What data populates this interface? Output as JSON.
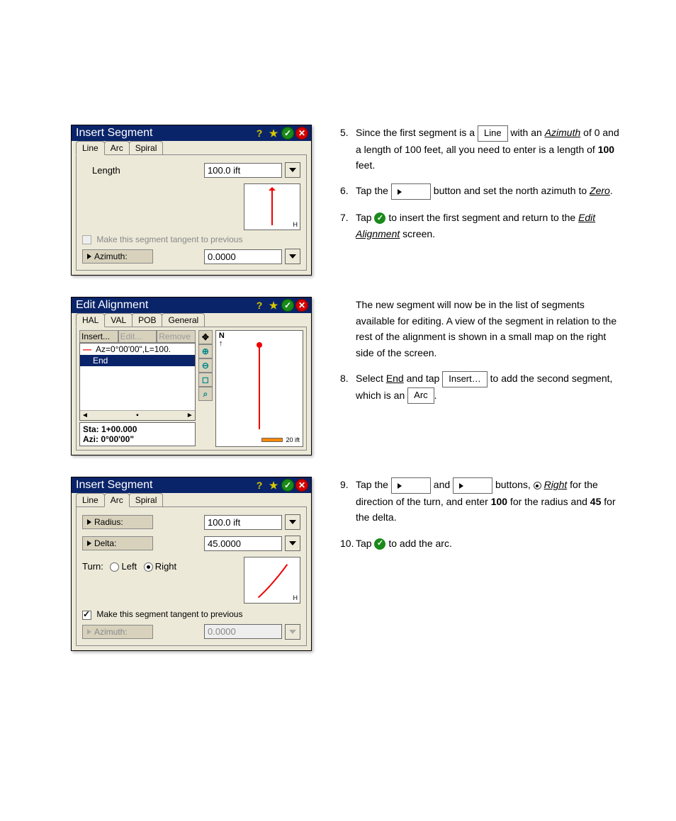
{
  "step_offset": 5,
  "dlg1": {
    "title": "Insert Segment",
    "tabs": [
      "Line",
      "Arc",
      "Spiral"
    ],
    "active_tab": 0,
    "length_label": "Length",
    "length_value": "100.0 ift",
    "tangent_label": "Make this segment tangent to previous",
    "azimuth_label": "Azimuth:",
    "azimuth_value": "0.0000"
  },
  "dlg2": {
    "title": "Edit Alignment",
    "tabs": [
      "HAL",
      "VAL",
      "POB",
      "General"
    ],
    "active_tab": 0,
    "btns": {
      "insert": "Insert...",
      "edit": "Edit...",
      "remove": "Remove"
    },
    "list": {
      "item0": "Az=0°00'00\",L=100.",
      "item1": "End"
    },
    "status1": "Sta: 1+00.000",
    "status2": "Azi: 0°00'00\"",
    "scale": "20 ift"
  },
  "dlg3": {
    "title": "Insert Segment",
    "tabs": [
      "Line",
      "Arc",
      "Spiral"
    ],
    "active_tab": 1,
    "radius_label": "Radius:",
    "radius_value": "100.0 ift",
    "delta_label": "Delta:",
    "delta_value": "45.0000",
    "turn_label": "Turn:",
    "left": "Left",
    "right": "Right",
    "tangent_label": "Make this segment tangent to previous",
    "azimuth_label": "Azimuth:",
    "azimuth_value": "0.0000"
  },
  "instr": {
    "s5a": "Since the first segment is a ",
    "s5_line": "Line",
    "s5b": " with an ",
    "s5_az": "Azimuth",
    "s5c": " of 0 and a length of 100 feet, all you need to enter is a length of ",
    "s5_len": "100",
    "s5d": " feet.",
    "s6a": "Tap the ",
    "s6b": " button and set the north azimuth to ",
    "s6_zero": "Zero",
    "s6c": ".",
    "s7a": "Tap ",
    "s7b": " to insert the first segment and return to the ",
    "s7_ea": "Edit Alignment",
    "s7c": " screen.",
    "s7p2": "The new segment will now be in the list of segments available for editing. A view of the segment in relation to the rest of the alignment is shown in a small map on the right side of the screen.",
    "s8a": "Select ",
    "s8_end": "End",
    "s8b": " and tap ",
    "s8_ins": "Insert…",
    "s8c": " to add the second segment, which is an ",
    "s8_arc": "Arc",
    "s8d": ".",
    "s9a": "Tap the ",
    "s9b": " and ",
    "s9c": " buttons, ",
    "s9_right": "Right",
    "s9d": " for the direction of the turn, and enter ",
    "s9_100": "100",
    "s9e": " for the radius and ",
    "s9_45": "45",
    "s9f": " for the delta.",
    "s10a": "Tap ",
    "s10b": " to add the arc."
  }
}
